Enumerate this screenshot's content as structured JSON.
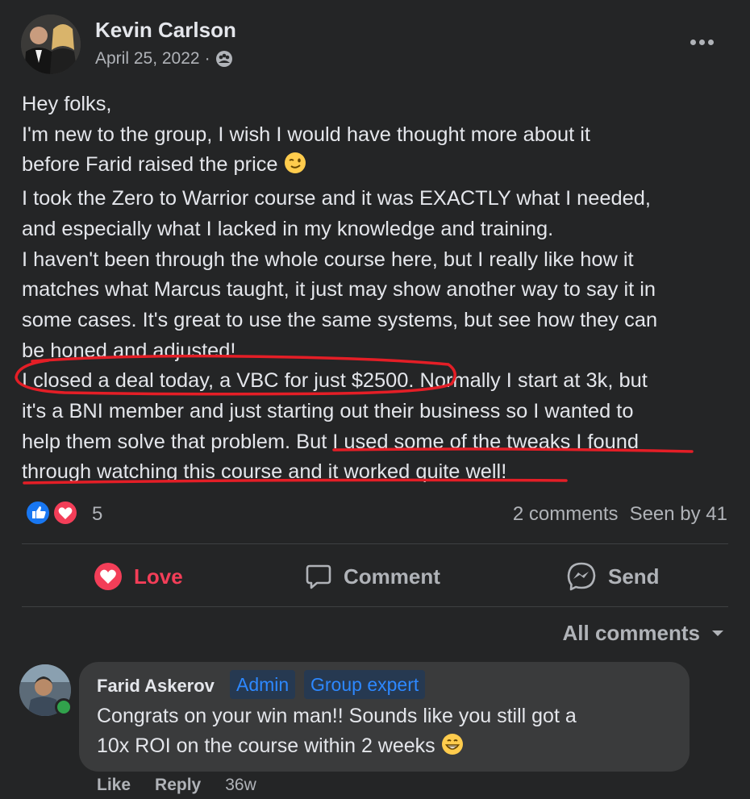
{
  "post": {
    "author": "Kevin Carlson",
    "date": "April 25, 2022",
    "separator": "·",
    "privacy_icon": "group-icon",
    "more_icon": "more-options-icon",
    "lines": [
      "Hey folks,",
      "I'm new to the group, I wish I would have thought more about it",
      "before Farid raised the price",
      "I took the Zero to Warrior course and it was EXACTLY what I needed,",
      "and especially what I lacked in my knowledge and training.",
      "I haven't been through the whole course here, but I really like how it",
      "matches what Marcus taught, it just may show another way to say it in",
      "some cases.  It's great to use the same systems, but see how they can",
      "be honed and adjusted!",
      "I closed a deal today, a VBC for just $2500.",
      " Normally I start at 3k, but",
      "it's a BNI member and just starting out their business so I wanted to",
      "help them solve that problem.  ",
      "But I used some of the tweaks I found",
      "through watching this course and it worked quite well!"
    ],
    "wink_emoji": "winking-face-emoji"
  },
  "reactions": {
    "icons": [
      "like-icon",
      "love-icon"
    ],
    "count": "5",
    "comments": "2 comments",
    "seen": "Seen by 41"
  },
  "actions": {
    "love": "Love",
    "comment": "Comment",
    "send": "Send"
  },
  "comments": {
    "filter": "All comments",
    "items": [
      {
        "name": "Farid Askerov",
        "badges": [
          "Admin",
          "Group expert"
        ],
        "lines": [
          "Congrats on your win man!! Sounds like you still got a",
          "10x ROI on the course within 2 weeks"
        ],
        "emoji": "grinning-face-emoji",
        "like": "Like",
        "reply": "Reply",
        "age": "36w"
      }
    ]
  },
  "colors": {
    "background": "#242526",
    "text": "#e4e6eb",
    "secondary": "#b0b3b8",
    "love": "#f33e58",
    "annotation": "#e41e26",
    "badge_text": "#2d88ff"
  }
}
